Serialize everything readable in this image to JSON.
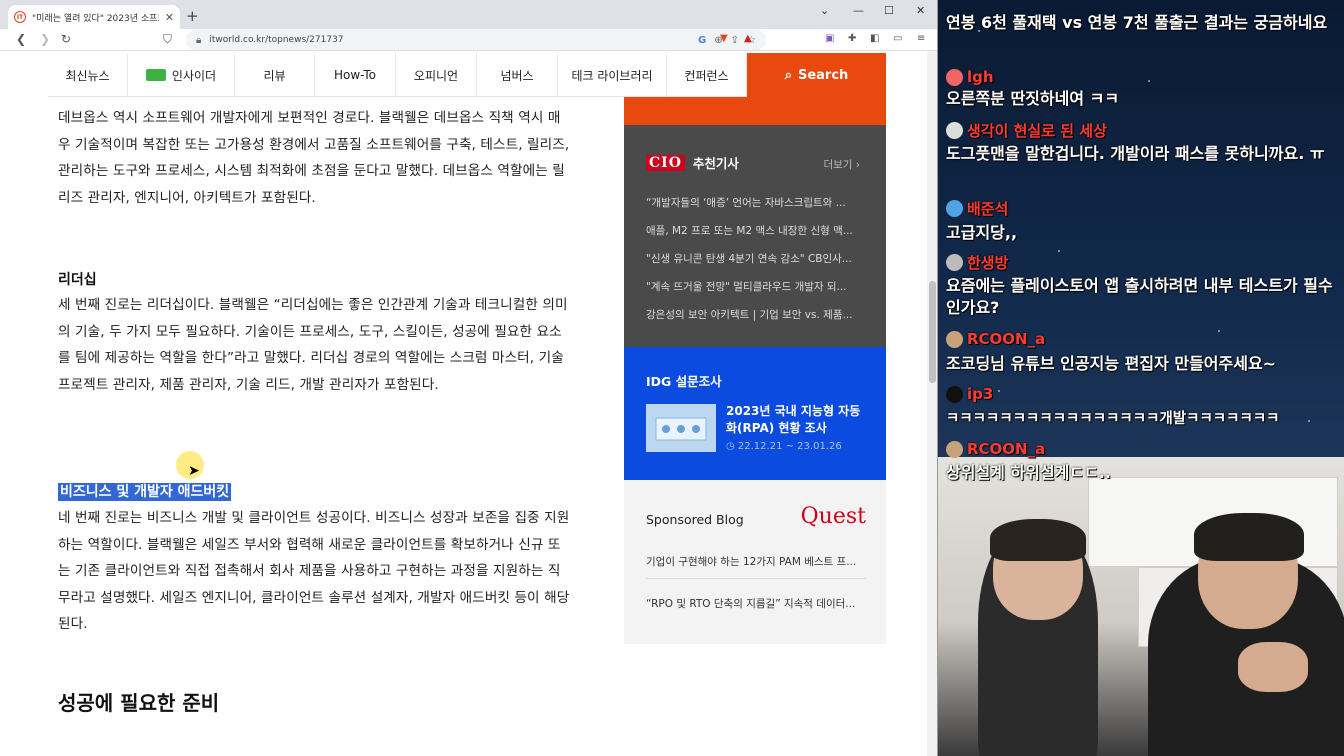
{
  "browser": {
    "tab_title": "\"미래는 열려 있다\" 2023년 소프트",
    "url": "itworld.co.kr/topnews/271737"
  },
  "nav": {
    "items": [
      "최신뉴스",
      "인사이더",
      "리뷰",
      "How-To",
      "오피니언",
      "넘버스",
      "테크 라이브러리",
      "컨퍼런스"
    ],
    "search_label": "Search"
  },
  "article": {
    "paragraph_devops": "데브옵스 역시 소프트웨어 개발자에게 보편적인 경로다. 블랙웰은 데브옵스 직책 역시 매우 기술적이며 복잡한 또는 고가용성 환경에서 고품질 소프트웨어를 구축, 테스트, 릴리즈, 관리하는 도구와 프로세스, 시스템 최적화에 초점을 둔다고 말했다. 데브옵스 역할에는 릴리즈 관리자, 엔지니어, 아키텍트가 포함된다.",
    "heading_leadership": "리더십",
    "paragraph_leadership": "세 번째 진로는 리더십이다. 블랙웰은 “리더십에는 좋은 인간관계 기술과 테크니컬한 의미의 기술, 두 가지 모두 필요하다. 기술이든 프로세스, 도구, 스킬이든, 성공에 필요한 요소를 팀에 제공하는 역할을 한다”라고 말했다. 리더십 경로의 역할에는 스크럼 마스터, 기술 프로젝트 관리자, 제품 관리자, 기술 리드, 개발 관리자가 포함된다.",
    "heading_business": "비즈니스 및 개발자 애드버킷",
    "paragraph_business": "네 번째 진로는 비즈니스 개발 및 클라이언트 성공이다. 비즈니스 성장과 보존을 집중 지원하는 역할이다. 블랙웰은 세일즈 부서와 협력해 새로운 클라이언트를 확보하거나 신규 또는 기존 클라이언트와 직접 접촉해서 회사 제품을 사용하고 구현하는 과정을 지원하는 직무라고 설명했다.  세일즈 엔지니어, 클라이언트 솔루션 설계자, 개발자 애드버킷 등이 해당된다.",
    "heading_success": "성공에 필요한 준비"
  },
  "sidebar": {
    "rec_logo": "CIO",
    "rec_title": "추천기사",
    "rec_more": "더보기 ›",
    "rec_items": [
      "“개발자들의 ‘애증’ 언어는 자바스크립트와 ...",
      "애플, M2 프로 또는 M2 맥스 내장한 신형 맥...",
      "\"신생 유니콘 탄생 4분기 연속 감소\" CB인사...",
      "\"계속 뜨거울 전망\" 멀티클라우드 개발자 되...",
      "강은성의 보안 아키텍트 | 기업 보안 vs. 제품..."
    ],
    "survey_title": "IDG 설문조사",
    "survey_name": "2023년 국내 지능형 자동화(RPA) 현황 조사",
    "survey_date": "22.12.21 ~ 23.01.26",
    "sponsored_title": "Sponsored Blog",
    "sponsored_logo": "Quest",
    "sponsored_items": [
      "기업이 구현해야 하는 12가지 PAM 베스트 프...",
      "“RPO 및 RTO 단축의 지름길” 지속적 데이터..."
    ]
  },
  "chat": [
    {
      "user": "",
      "message": "연봉 6천 풀재택 vs 연봉 7천 풀출근 결과는 궁금하네요"
    },
    {
      "user": "lgh",
      "message": "오른쪽분 딴짓하네여 ㅋㅋ"
    },
    {
      "user": "생각이 현실로 된 세상",
      "message": "도그풋맨을 말한겁니다. 개발이라 패스를 못하니까요. ㅠ"
    },
    {
      "user": "배준석",
      "message": "고급지당,,"
    },
    {
      "user": "한생방",
      "message": "요즘에는 플레이스토어 앱 출시하려면 내부 테스트가 필수인가요?"
    },
    {
      "user": "RCOON_a",
      "message": "조코딩님 유튜브 인공지능 편집자 만들어주세요~"
    },
    {
      "user": "ip3",
      "message": "ㅋㅋㅋㅋㅋㅋㅋㅋㅋㅋㅋㅋㅋㅋㅋㅋ개발ㅋㅋㅋㅋㅋㅋㅋ"
    },
    {
      "user": "RCOON_a",
      "message": "상위설계 하위설계ㄷㄷ.."
    }
  ]
}
